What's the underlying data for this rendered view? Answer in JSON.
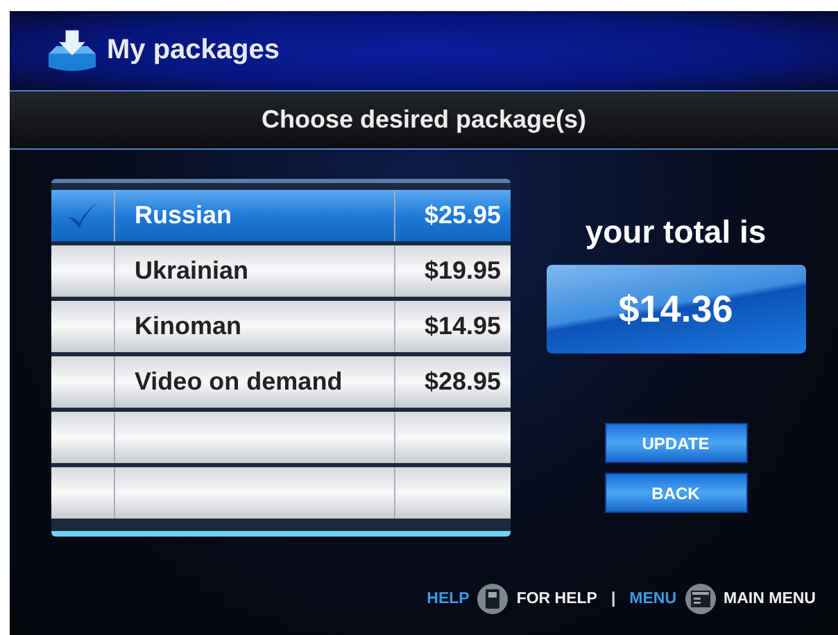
{
  "header": {
    "title": "My packages"
  },
  "subheader": "Choose desired package(s)",
  "packages": [
    {
      "name": "Russian",
      "price": "$25.95",
      "selected": true
    },
    {
      "name": "Ukrainian",
      "price": "$19.95",
      "selected": false
    },
    {
      "name": "Kinoman",
      "price": "$14.95",
      "selected": false
    },
    {
      "name": "Video on demand",
      "price": "$28.95",
      "selected": false
    },
    {
      "selected": false
    },
    {
      "selected": false
    }
  ],
  "total": {
    "label": "your total is",
    "value": "$14.36"
  },
  "buttons": [
    "UPDATE",
    "BACK"
  ],
  "footer": [
    {
      "key": "HELP",
      "action": "FOR HELP"
    },
    {
      "key": "MENU",
      "action": "MAIN MENU"
    }
  ],
  "footer_separator": "|"
}
